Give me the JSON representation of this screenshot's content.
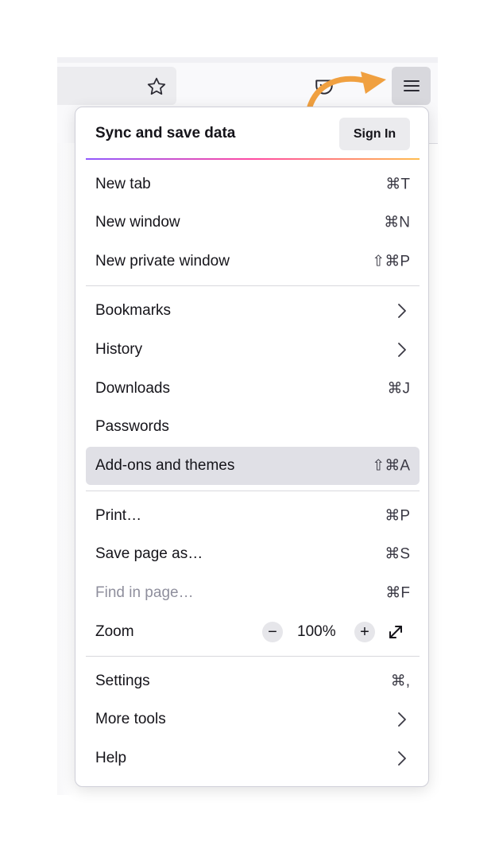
{
  "header": {
    "title": "Sync and save data",
    "signin_label": "Sign In"
  },
  "menu": {
    "new_tab": {
      "label": "New tab",
      "shortcut": "⌘T"
    },
    "new_window": {
      "label": "New window",
      "shortcut": "⌘N"
    },
    "new_private_window": {
      "label": "New private window",
      "shortcut": "⇧⌘P"
    },
    "bookmarks": {
      "label": "Bookmarks"
    },
    "history": {
      "label": "History"
    },
    "downloads": {
      "label": "Downloads",
      "shortcut": "⌘J"
    },
    "passwords": {
      "label": "Passwords"
    },
    "addons": {
      "label": "Add-ons and themes",
      "shortcut": "⇧⌘A"
    },
    "print": {
      "label": "Print…",
      "shortcut": "⌘P"
    },
    "save_page": {
      "label": "Save page as…",
      "shortcut": "⌘S"
    },
    "find": {
      "label": "Find in page…",
      "shortcut": "⌘F"
    },
    "zoom": {
      "label": "Zoom",
      "minus": "−",
      "value": "100%",
      "plus": "+"
    },
    "settings": {
      "label": "Settings",
      "shortcut": "⌘,"
    },
    "more_tools": {
      "label": "More tools"
    },
    "help": {
      "label": "Help"
    }
  },
  "icons": {
    "toolbar": [
      "star-icon",
      "pocket-icon",
      "hamburger-menu-icon",
      "annotation-arrow-icon"
    ],
    "menu": [
      "chevron-right-icon",
      "fullscreen-icon"
    ]
  },
  "colors": {
    "arrow": "#f0a040",
    "highlight": "#e0e0e6",
    "menu_button": "#d8d8dd"
  }
}
